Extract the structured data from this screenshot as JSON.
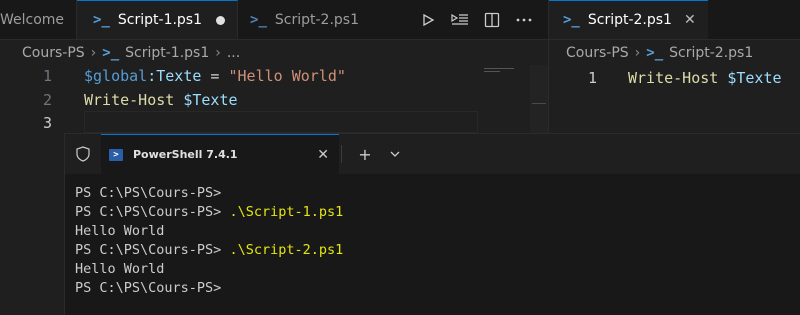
{
  "left_group": {
    "tabs": [
      {
        "label": "Welcome"
      },
      {
        "label": "Script-1.ps1",
        "icon": "powershell-icon",
        "dirty": true
      },
      {
        "label": "Script-2.ps1",
        "icon": "powershell-icon"
      }
    ],
    "breadcrumb": [
      "Cours-PS",
      "Script-1.ps1",
      "..."
    ],
    "lines": [
      {
        "num": "1",
        "tokens": [
          {
            "t": "$global",
            "c": "glob"
          },
          {
            "t": ":Texte",
            "c": "var"
          },
          {
            "t": " = ",
            "c": "plain"
          },
          {
            "t": "\"Hello World\"",
            "c": "str"
          }
        ]
      },
      {
        "num": "2",
        "tokens": [
          {
            "t": "Write-Host",
            "c": "cmd"
          },
          {
            "t": " ",
            "c": "plain"
          },
          {
            "t": "$Texte",
            "c": "var"
          }
        ]
      },
      {
        "num": "3",
        "tokens": []
      }
    ],
    "line1": {
      "num": "1",
      "t1": "$global",
      "t2": ":Texte",
      "t3": " = ",
      "t4": "\"Hello World\""
    },
    "line2": {
      "num": "2",
      "t1": "Write-Host",
      "t2": " ",
      "t3": "$Texte"
    },
    "line3": {
      "num": "3"
    }
  },
  "right_group": {
    "tab": {
      "label": "Script-2.ps1",
      "icon": "powershell-icon"
    },
    "breadcrumb": [
      "Cours-PS",
      "Script-2.ps1"
    ],
    "line1": {
      "num": "1",
      "t1": "Write-Host",
      "t2": " ",
      "t3": "$Texte"
    }
  },
  "terminal": {
    "tab_title": "PowerShell 7.4.1",
    "lines": [
      {
        "prompt": "PS C:\\PS\\Cours-PS>",
        "cmd": ""
      },
      {
        "prompt": "PS C:\\PS\\Cours-PS>",
        "cmd": " .\\Script-1.ps1"
      },
      {
        "prompt": "Hello World",
        "cmd": ""
      },
      {
        "prompt": "PS C:\\PS\\Cours-PS>",
        "cmd": " .\\Script-2.ps1"
      },
      {
        "prompt": "Hello World",
        "cmd": ""
      },
      {
        "prompt": "PS C:\\PS\\Cours-PS>",
        "cmd": ""
      }
    ]
  },
  "colors": {
    "accent": "#0078d4",
    "string": "#ce9178",
    "variable": "#9cdcfe",
    "command": "#dcdcaa",
    "terminal_command": "#e5e510"
  }
}
